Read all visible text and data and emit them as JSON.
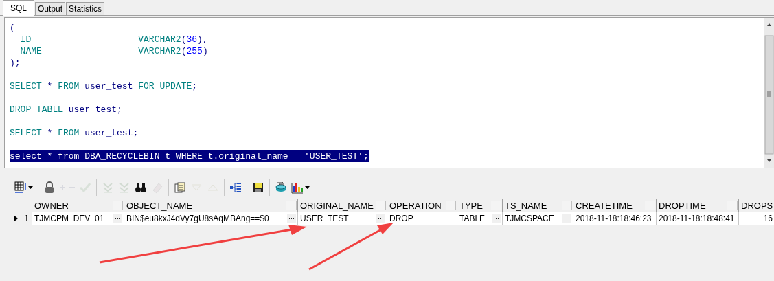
{
  "tabs": [
    {
      "label": "SQL",
      "selected": true
    },
    {
      "label": "Output",
      "selected": false
    },
    {
      "label": "Statistics",
      "selected": false
    }
  ],
  "editor": {
    "lines": [
      {
        "kind": "code",
        "selected": false,
        "tokens": [
          {
            "text": "(",
            "kind": "punct"
          }
        ]
      },
      {
        "kind": "code",
        "selected": false,
        "tokens": [
          {
            "text": "  ID                    ",
            "kind": "keyword"
          },
          {
            "text": "VARCHAR2",
            "kind": "keyword"
          },
          {
            "text": "(",
            "kind": "punct"
          },
          {
            "text": "36",
            "kind": "number"
          },
          {
            "text": "),",
            "kind": "punct"
          }
        ]
      },
      {
        "kind": "code",
        "selected": false,
        "tokens": [
          {
            "text": "  NAME                  ",
            "kind": "keyword"
          },
          {
            "text": "VARCHAR2",
            "kind": "keyword"
          },
          {
            "text": "(",
            "kind": "punct"
          },
          {
            "text": "255",
            "kind": "number"
          },
          {
            "text": ")",
            "kind": "punct"
          }
        ]
      },
      {
        "kind": "code",
        "selected": false,
        "tokens": [
          {
            "text": ");",
            "kind": "punct"
          }
        ]
      },
      {
        "kind": "blank"
      },
      {
        "kind": "code",
        "selected": false,
        "tokens": [
          {
            "text": "SELECT",
            "kind": "keyword"
          },
          {
            "text": " * ",
            "kind": "punct"
          },
          {
            "text": "FROM",
            "kind": "keyword"
          },
          {
            "text": " user_test ",
            "kind": "ident"
          },
          {
            "text": "FOR UPDATE",
            "kind": "keyword"
          },
          {
            "text": ";",
            "kind": "punct"
          }
        ]
      },
      {
        "kind": "blank"
      },
      {
        "kind": "code",
        "selected": false,
        "tokens": [
          {
            "text": "DROP TABLE",
            "kind": "keyword"
          },
          {
            "text": " user_test;",
            "kind": "ident"
          }
        ]
      },
      {
        "kind": "blank"
      },
      {
        "kind": "code",
        "selected": false,
        "tokens": [
          {
            "text": "SELECT",
            "kind": "keyword"
          },
          {
            "text": " * ",
            "kind": "punct"
          },
          {
            "text": "FROM",
            "kind": "keyword"
          },
          {
            "text": " user_test;",
            "kind": "ident"
          }
        ]
      },
      {
        "kind": "blank"
      },
      {
        "kind": "code",
        "selected": true,
        "tokens": [
          {
            "text": "select * from DBA_RECYCLEBIN t WHERE t.original_name = 'USER_TEST';"
          }
        ]
      }
    ]
  },
  "toolbar": [
    [
      {
        "kind": "grid",
        "disabled": false,
        "dropdown": true
      }
    ],
    [
      {
        "kind": "lock",
        "disabled": false,
        "dropdown": false
      },
      {
        "kind": "plus",
        "disabled": true,
        "dropdown": false
      },
      {
        "kind": "minus",
        "disabled": true,
        "dropdown": false
      },
      {
        "kind": "check",
        "disabled": true,
        "dropdown": false
      }
    ],
    [
      {
        "kind": "chevrons",
        "disabled": true,
        "dropdown": false
      },
      {
        "kind": "chevrons",
        "disabled": true,
        "dropdown": false
      },
      {
        "kind": "binoculars",
        "disabled": false,
        "dropdown": false
      },
      {
        "kind": "eraser",
        "disabled": true,
        "dropdown": false
      }
    ],
    [
      {
        "kind": "documents",
        "disabled": false,
        "dropdown": false
      },
      {
        "kind": "down",
        "disabled": true,
        "dropdown": false
      },
      {
        "kind": "up",
        "disabled": true,
        "dropdown": false
      }
    ],
    [
      {
        "kind": "tree",
        "disabled": false,
        "dropdown": false
      }
    ],
    [
      {
        "kind": "floppy",
        "disabled": false,
        "dropdown": false
      }
    ],
    [
      {
        "kind": "database",
        "disabled": false,
        "dropdown": false
      },
      {
        "kind": "chart",
        "disabled": false,
        "dropdown": true
      }
    ]
  ],
  "grid": {
    "columns": [
      "OWNER",
      "OBJECT_NAME",
      "ORIGINAL_NAME",
      "OPERATION",
      "TYPE",
      "TS_NAME",
      "CREATETIME",
      "DROPTIME",
      "DROPS"
    ],
    "rows": [
      {
        "number": "1",
        "current": true,
        "cells": [
          {
            "text": "TJMCPM_DEV_01",
            "button": "···"
          },
          {
            "text": "BIN$eu8kxJ4dVy7gU8sAqMBAng==$0",
            "button": "···"
          },
          {
            "text": "USER_TEST",
            "button": "···"
          },
          {
            "text": "DROP"
          },
          {
            "text": "TABLE",
            "button": "···"
          },
          {
            "text": "TJMCSPACE",
            "button": "···"
          },
          {
            "text": "2018-11-18:18:46:23"
          },
          {
            "text": "2018-11-18:18:48:41"
          },
          {
            "text": "16"
          }
        ]
      }
    ]
  }
}
